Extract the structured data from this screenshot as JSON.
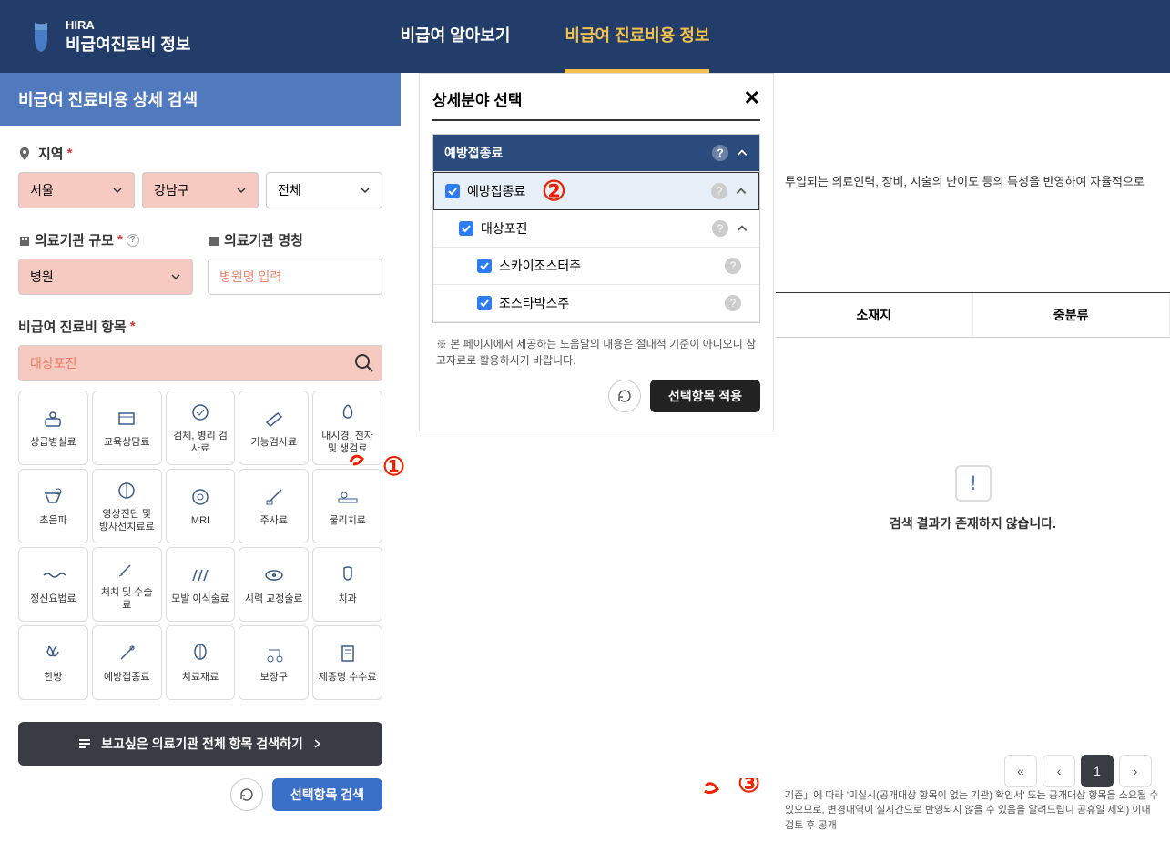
{
  "header": {
    "brand_small": "HIRA",
    "brand_big": "비급여진료비 정보",
    "tab1": "비급여 알아보기",
    "tab2": "비급여 진료비용 정보"
  },
  "search_panel": {
    "title": "비급여 진료비용 상세 검색",
    "region_label": "지역",
    "region_sel1": "서울",
    "region_sel2": "강남구",
    "region_sel3": "전체",
    "scale_label": "의료기관 규모",
    "scale_sel": "병원",
    "name_label": "의료기관 명칭",
    "name_placeholder": "병원명 입력",
    "items_label": "비급여 진료비 항목",
    "items_placeholder": "대상포진",
    "categories": [
      "상급병실료",
      "교육상담료",
      "검체, 병리 검사료",
      "기능검사료",
      "내시경, 천자 및 생검료",
      "초음파",
      "영상진단 및 방사선치료료",
      "MRI",
      "주사료",
      "물리치료",
      "정신요법료",
      "처치 및 수술료",
      "모발 이식술료",
      "시력 교정술료",
      "치과",
      "한방",
      "예방접종료",
      "치료재료",
      "보장구",
      "제증명 수수료"
    ],
    "big_btn": "보고싶은 의료기관 전체 항목 검색하기",
    "primary_btn": "선택항목 검색"
  },
  "popup": {
    "title": "상세분야 선택",
    "group_header": "예방접종료",
    "row1": "예방접종료",
    "row2": "대상포진",
    "row3": "스카이조스터주",
    "row4": "조스타박스주",
    "footer_text": "※ 본 페이지에서 제공하는 도움말의 내용은 절대적 기준이 아니오니 참고자료로 활용하시기 바랍니다.",
    "apply_btn": "선택항목 적용"
  },
  "right": {
    "desc": "투입되는 의료인력, 장비, 시술의 난이도 등의 특성을 반영하여 자율적으로",
    "th1": "소재지",
    "th2": "중분류",
    "no_results": "검색 결과가 존재하지 않습니다.",
    "footnote": "기준」에 따라 '미실시(공개대상 항목이 없는 기관) 확인서' 또는 공개대상 항목을 소요될 수 있으므로, 변경내역이 실시간으로 반영되지 않을 수 있음을 알려드립니 공휴일 제외) 이내 검토 후 공개"
  }
}
